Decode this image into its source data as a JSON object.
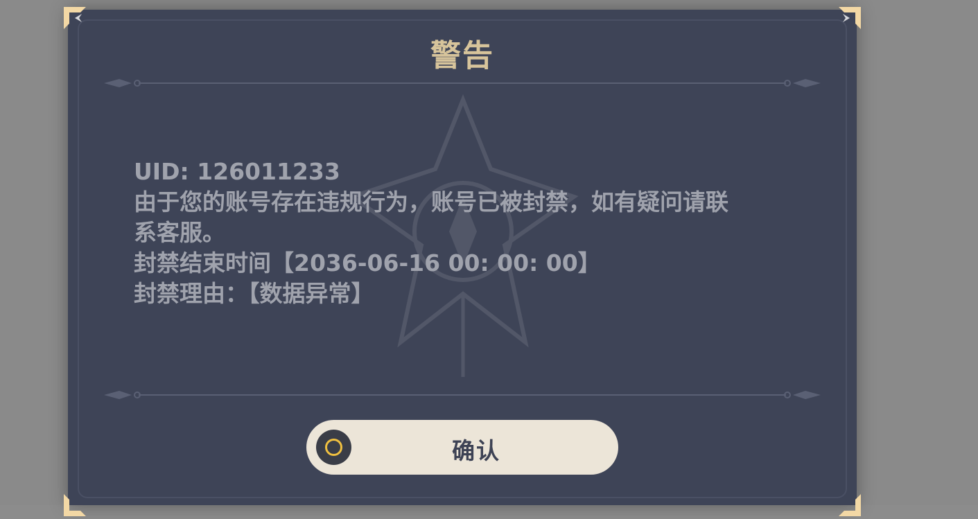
{
  "dialog": {
    "title": "警告",
    "lines": [
      "UID: 126011233",
      "由于您的账号存在违规行为，账号已被封禁，如有疑问请联",
      "系客服。",
      "封禁结束时间【2036-06-16 00: 00: 00】",
      "封禁理由：【数据异常】"
    ],
    "confirm_label": "确认",
    "confirm_icon": "circle-icon"
  },
  "colors": {
    "panel": "#3e4457",
    "title": "#d7c49b",
    "text": "#a0a3ad",
    "button": "#ece5d8",
    "accent": "#f0c040"
  }
}
